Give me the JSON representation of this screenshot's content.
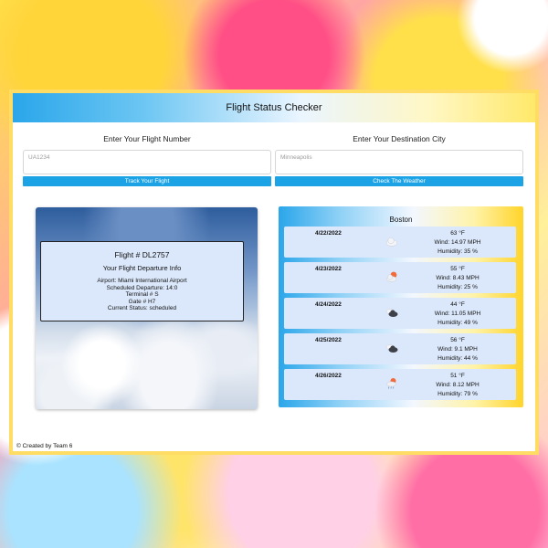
{
  "app": {
    "title": "Flight Status Checker",
    "footer": "© Created by Team 6"
  },
  "flight_search": {
    "label": "Enter Your Flight Number",
    "placeholder": "UA1234",
    "button": "Track Your Flight"
  },
  "city_search": {
    "label": "Enter Your Destination City",
    "placeholder": "Minneapolis",
    "button": "Check The Weather"
  },
  "flight": {
    "number": "Flight # DL2757",
    "subtitle": "Your Flight Departure Info",
    "airport": "Airport: Miami International Airport",
    "scheduled": "Scheduled Departure: 14:0",
    "terminal": "Terminal # S",
    "gate": "Gate # H7",
    "status": "Current Status: scheduled"
  },
  "weather": {
    "city": "Boston",
    "days": [
      {
        "date": "4/22/2022",
        "icon": "cloud-icon",
        "temp": "63 °F",
        "wind": "Wind: 14.97 MPH",
        "humidity": "Humidity: 35 %"
      },
      {
        "date": "4/23/2022",
        "icon": "sun-cloud-icon",
        "temp": "55 °F",
        "wind": "Wind: 8.43 MPH",
        "humidity": "Humidity: 25 %"
      },
      {
        "date": "4/24/2022",
        "icon": "dark-cloud-icon",
        "temp": "44 °F",
        "wind": "Wind: 11.05 MPH",
        "humidity": "Humidity: 49 %"
      },
      {
        "date": "4/25/2022",
        "icon": "dark-cloud-icon",
        "temp": "56 °F",
        "wind": "Wind: 9.1 MPH",
        "humidity": "Humidity: 44 %"
      },
      {
        "date": "4/26/2022",
        "icon": "sun-rain-icon",
        "temp": "51 °F",
        "wind": "Wind: 8.12 MPH",
        "humidity": "Humidity: 79 %"
      }
    ]
  },
  "colors": {
    "accent": "#1ba3e6",
    "frame": "#ffdc63",
    "card": "#dbe8fb"
  }
}
